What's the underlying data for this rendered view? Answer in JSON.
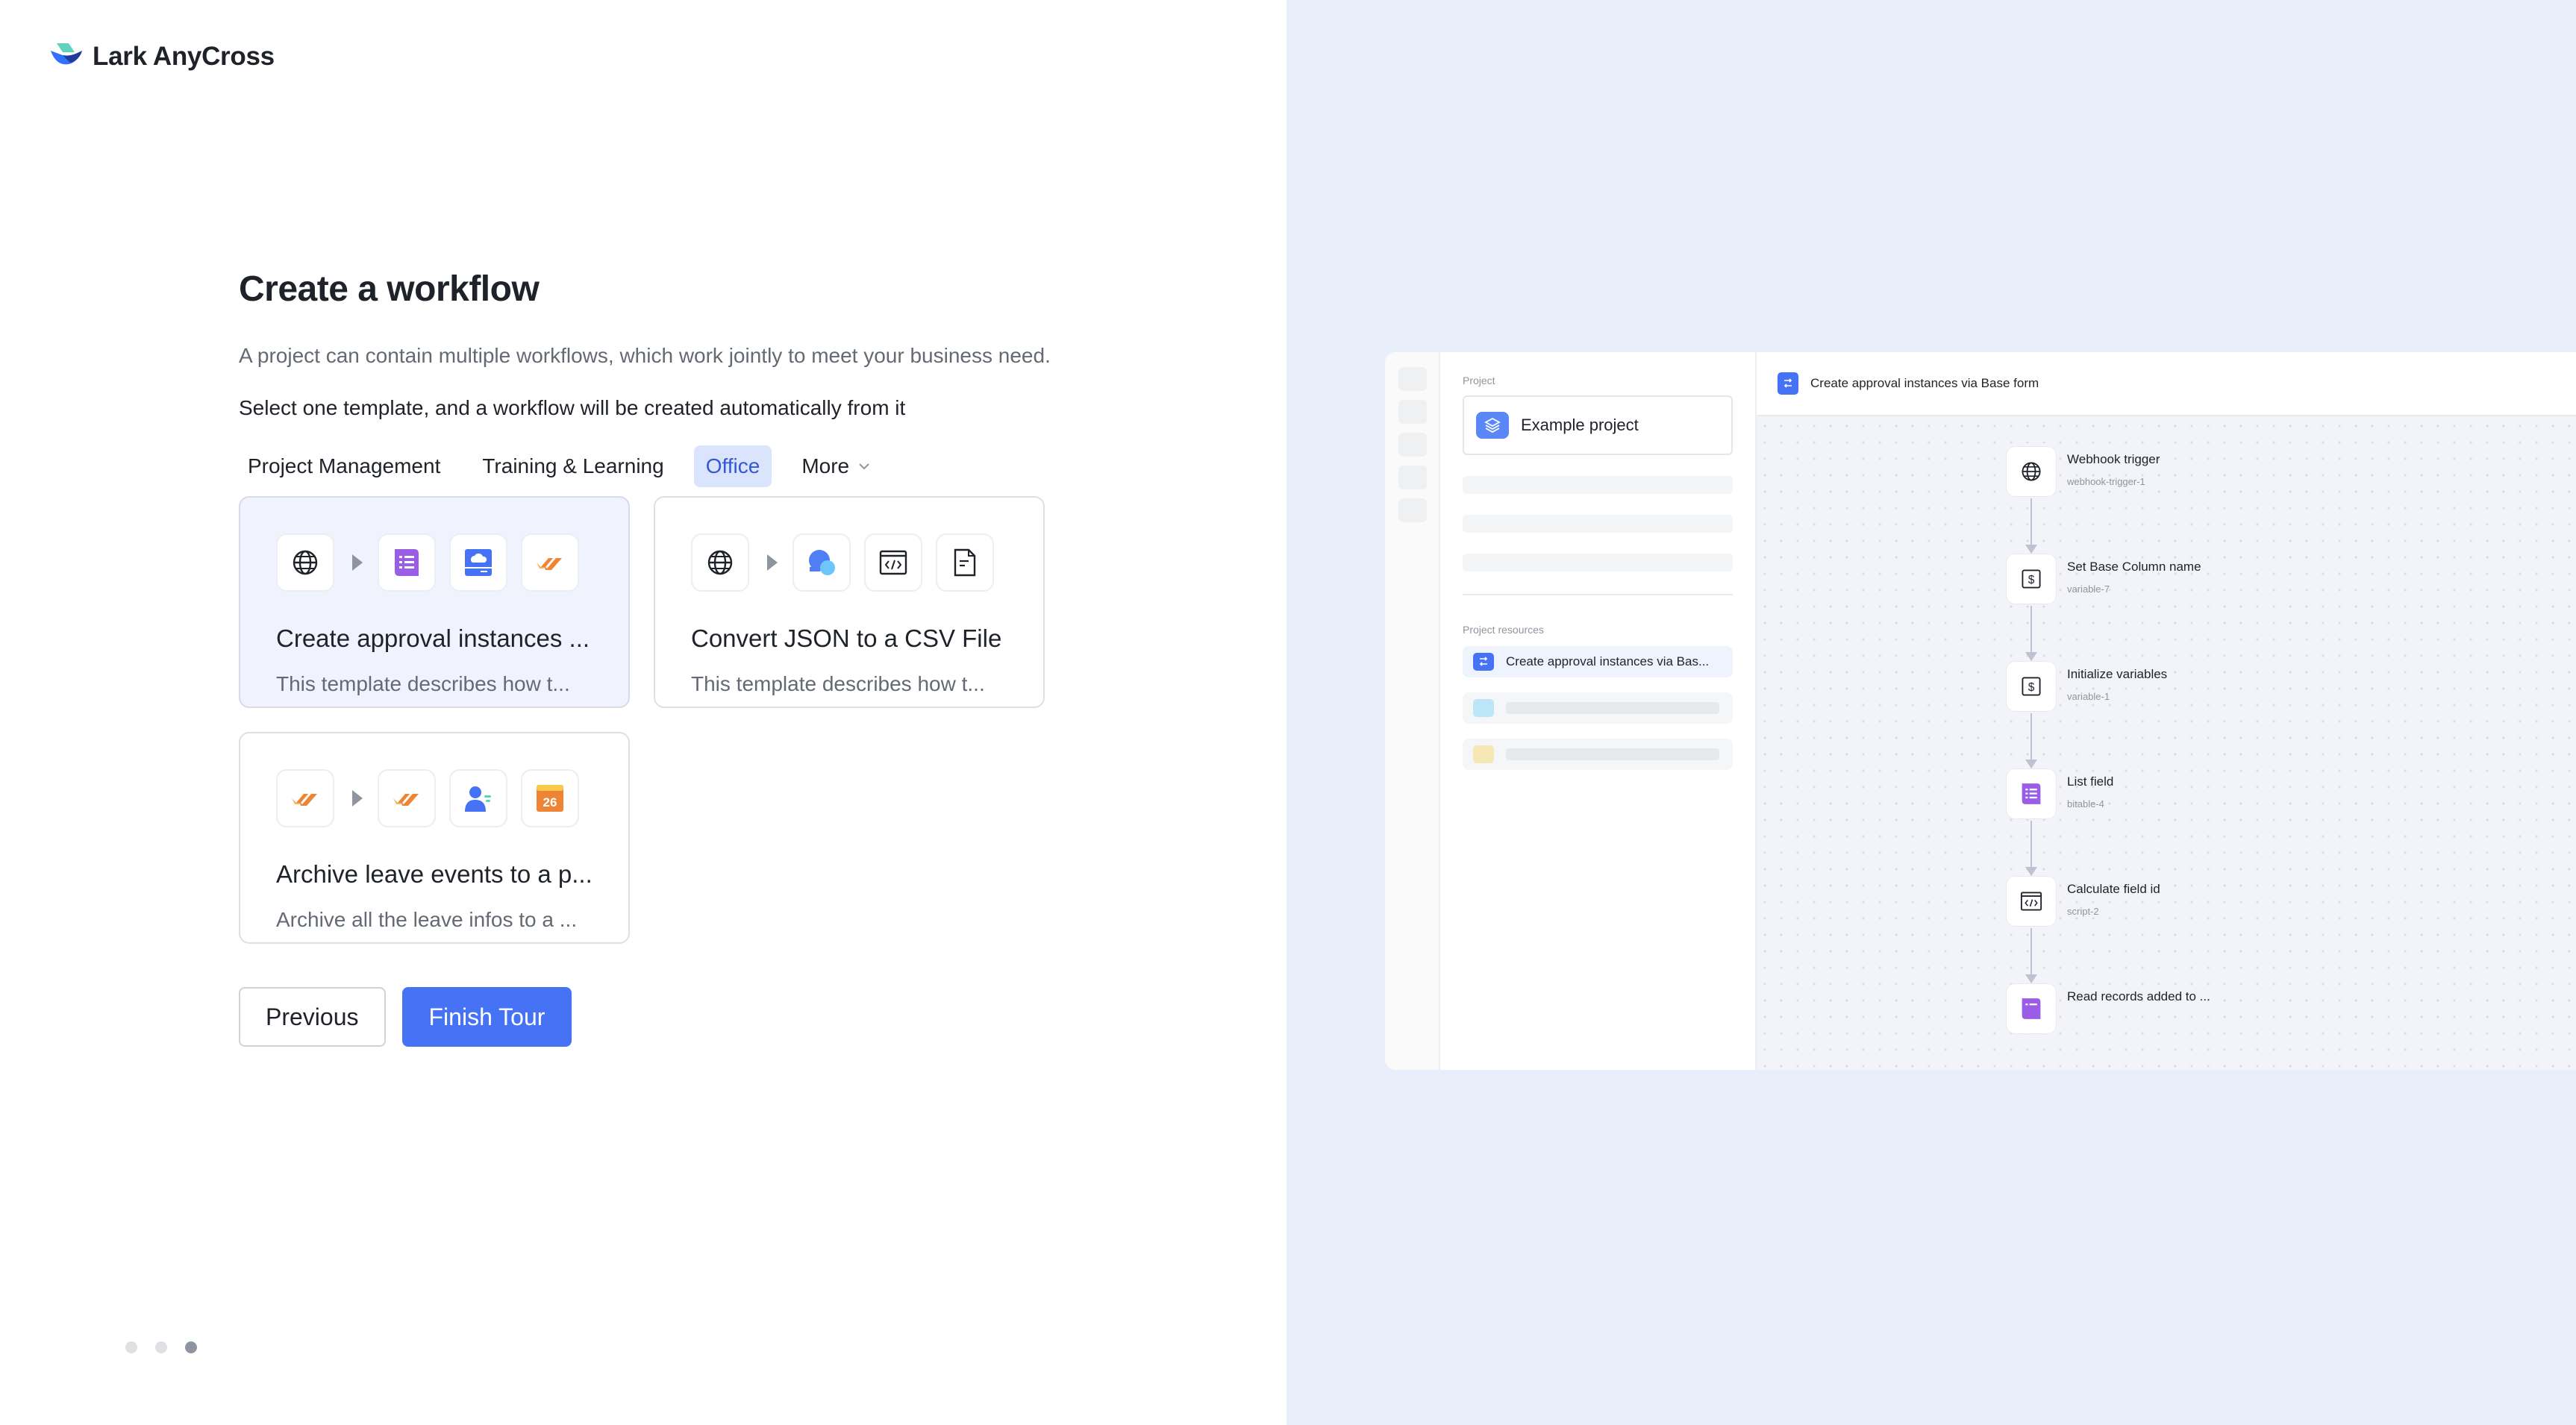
{
  "brand": {
    "name": "Lark AnyCross",
    "logo_icon": "lark-bird-logo"
  },
  "main": {
    "title": "Create a workflow",
    "description": "A project can contain multiple workflows, which work jointly to meet your business need.",
    "instruction": "Select one template, and a workflow will be created automatically from it",
    "tabs": [
      {
        "label": "Project Management",
        "active": false
      },
      {
        "label": "Training & Learning",
        "active": false
      },
      {
        "label": "Office",
        "active": true
      },
      {
        "label": "More",
        "active": false,
        "icon": "chevron-down-icon"
      }
    ],
    "templates": [
      {
        "title": "Create approval instances ...",
        "description": "This template describes how t...",
        "selected": true,
        "icons": [
          "webhook-globe-icon",
          "base-table-icon",
          "cloud-drive-icon",
          "approval-check-icon"
        ]
      },
      {
        "title": "Convert JSON to a CSV File",
        "description": "This template describes how t...",
        "selected": false,
        "icons": [
          "webhook-globe-icon",
          "chat-bubble-icon",
          "code-script-icon",
          "document-file-icon"
        ]
      },
      {
        "title": "Archive leave events to a p...",
        "description": "Archive all the leave infos to a ...",
        "selected": false,
        "icons": [
          "approval-check-icon",
          "approval-check-icon",
          "contact-user-icon",
          "calendar-icon"
        ]
      }
    ],
    "calendar_day": "26",
    "buttons": {
      "previous": "Previous",
      "finish": "Finish Tour"
    },
    "pagination": {
      "total": 3,
      "current": 3
    }
  },
  "preview": {
    "project_label": "Project",
    "project_name": "Example project",
    "resources_label": "Project resources",
    "resource_item": "Create approval instances via Bas...",
    "workflow_title": "Create approval instances via Base form",
    "nodes": [
      {
        "label": "Webhook trigger",
        "id": "webhook-trigger-1",
        "icon": "webhook-globe-icon"
      },
      {
        "label": "Set Base Column name",
        "id": "variable-7",
        "icon": "variable-dollar-icon"
      },
      {
        "label": "Initialize variables",
        "id": "variable-1",
        "icon": "variable-dollar-icon"
      },
      {
        "label": "List field",
        "id": "bitable-4",
        "icon": "base-table-icon"
      },
      {
        "label": "Calculate field id",
        "id": "script-2",
        "icon": "code-script-icon"
      },
      {
        "label": "Read records added to ...",
        "id": "",
        "icon": "base-table-icon"
      }
    ]
  },
  "colors": {
    "primary": "#4673f6",
    "tab_active_bg": "#dbe4fd",
    "tab_active_text": "#3358d4",
    "right_panel_bg": "#e8eefa",
    "card_selected_bg": "#f0f3fe",
    "base_purple": "#9a5ee6",
    "approval_orange": "#ee8535"
  }
}
